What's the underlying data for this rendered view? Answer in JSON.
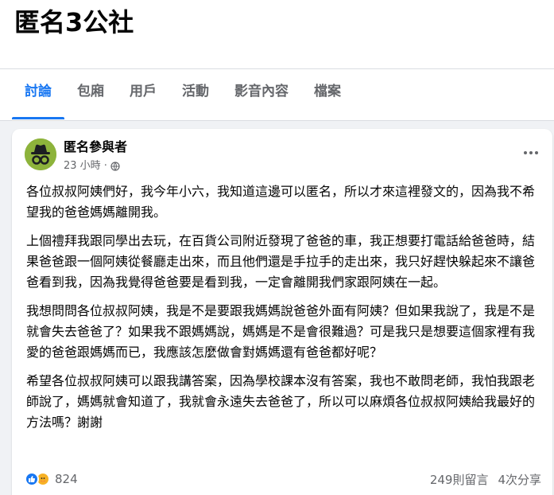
{
  "group": {
    "title": "匿名3公社"
  },
  "tabs": [
    {
      "label": "討論",
      "active": true
    },
    {
      "label": "包廂"
    },
    {
      "label": "用戶"
    },
    {
      "label": "活動"
    },
    {
      "label": "影音內容"
    },
    {
      "label": "檔案"
    }
  ],
  "post": {
    "author": "匿名參與者",
    "time": "23 小時",
    "separator": "·",
    "privacy_icon": "globe-icon",
    "menu_icon": "more-options-icon",
    "paragraphs": [
      "各位叔叔阿姨們好，我今年小六，我知道這邊可以匿名，所以才來這裡發文的，因為我不希望我的爸爸媽媽離開我。",
      "上個禮拜我跟同學出去玩，在百貨公司附近發現了爸爸的車，我正想要打電話給爸爸時，結果爸爸跟一個阿姨從餐廳走出來，而且他們還是手拉手的走出來，我只好趕快躲起來不讓爸爸看到我，因為我覺得爸爸要是看到我，一定會離開我們家跟阿姨在一起。",
      "我想問問各位叔叔阿姨，我是不是要跟我媽媽說爸爸外面有阿姨？但如果我說了，我是不是就會失去爸爸了？如果我不跟媽媽說，媽媽是不是會很難過？可是我只是想要這個家裡有我愛的爸爸跟媽媽而已，我應該怎麼做會對媽媽還有爸爸都好呢？",
      "希望各位叔叔阿姨可以跟我講答案，因為學校課本沒有答案，我也不敢問老師，我怕我跟老師說了，媽媽就會知道了，我就會永遠失去爸爸了，所以可以麻煩各位叔叔阿姨給我最好的方法嗎？謝謝"
    ],
    "reactions": {
      "icons": [
        "like-icon",
        "care-icon"
      ],
      "count": "824"
    },
    "comments": "249則留言",
    "shares": "4次分享"
  },
  "colors": {
    "accent": "#1877f2",
    "avatar": "#8db33b",
    "care": "#f7b125",
    "muted": "#65676b"
  }
}
